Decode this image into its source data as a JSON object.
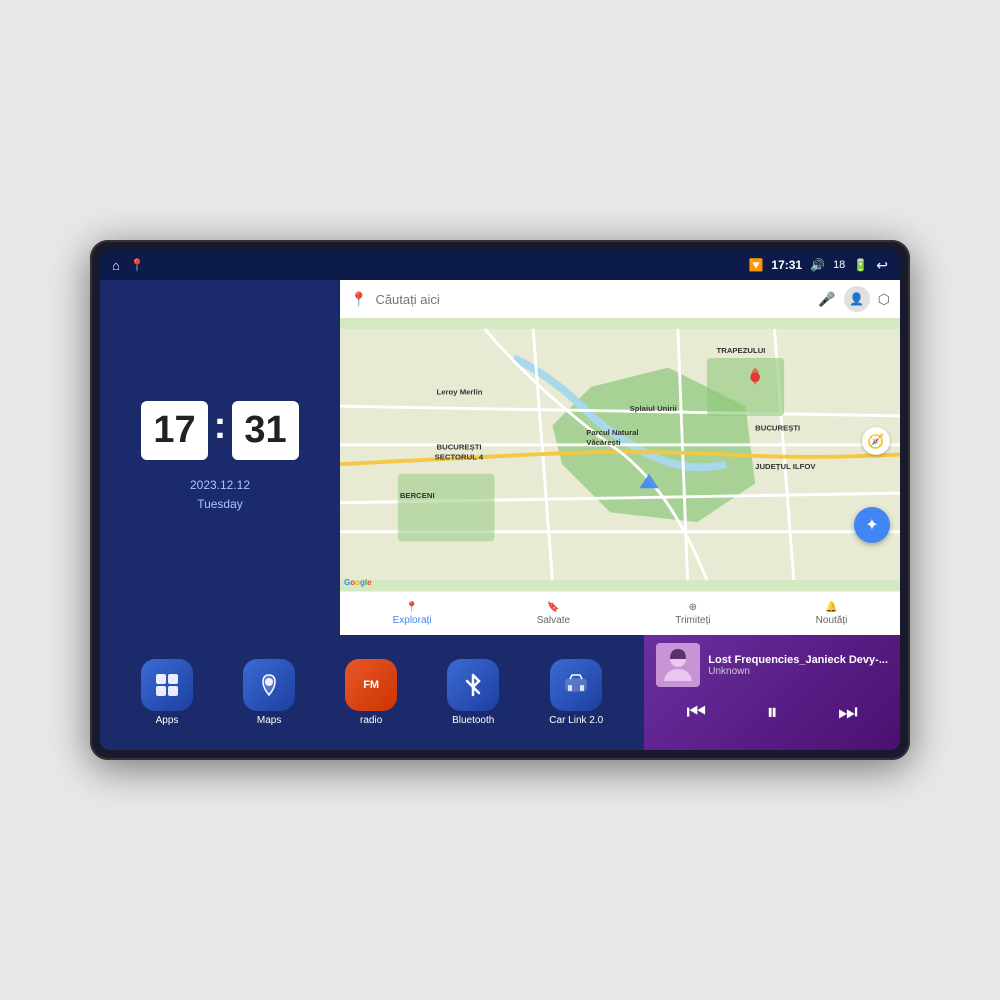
{
  "device": {
    "status_bar": {
      "left_icons": [
        "home-icon",
        "maps-pin-icon"
      ],
      "time": "17:31",
      "signal_icon": "signal-icon",
      "volume_icon": "volume-icon",
      "volume_level": "18",
      "battery_icon": "battery-icon",
      "back_icon": "back-icon"
    },
    "clock": {
      "hours": "17",
      "minutes": "31",
      "date": "2023.12.12",
      "day": "Tuesday"
    },
    "map": {
      "search_placeholder": "Căutați aici",
      "tabs": [
        {
          "label": "Explorați",
          "active": true
        },
        {
          "label": "Salvate",
          "active": false
        },
        {
          "label": "Trimiteți",
          "active": false
        },
        {
          "label": "Noutăți",
          "active": false
        }
      ],
      "labels": [
        "TRAPEZULUI",
        "BUCUREȘTI",
        "JUDEȚUL ILFOV",
        "Parcul Natural Văcărești",
        "Leroy Merlin",
        "BERCENI",
        "BUCUREȘTI SECTORUL 4"
      ]
    },
    "apps": [
      {
        "id": "apps",
        "label": "Apps",
        "icon": "grid-icon",
        "color": "#3a6bd4"
      },
      {
        "id": "maps",
        "label": "Maps",
        "icon": "map-icon",
        "color": "#3a6bd4"
      },
      {
        "id": "radio",
        "label": "radio",
        "icon": "radio-icon",
        "color": "#e8572a"
      },
      {
        "id": "bluetooth",
        "label": "Bluetooth",
        "icon": "bluetooth-icon",
        "color": "#3a6bd4"
      },
      {
        "id": "carlink",
        "label": "Car Link 2.0",
        "icon": "car-icon",
        "color": "#3a6bd4"
      }
    ],
    "music": {
      "title": "Lost Frequencies_Janieck Devy-...",
      "artist": "Unknown",
      "controls": {
        "prev": "⏮",
        "play_pause": "⏸",
        "next": "⏭"
      }
    }
  }
}
